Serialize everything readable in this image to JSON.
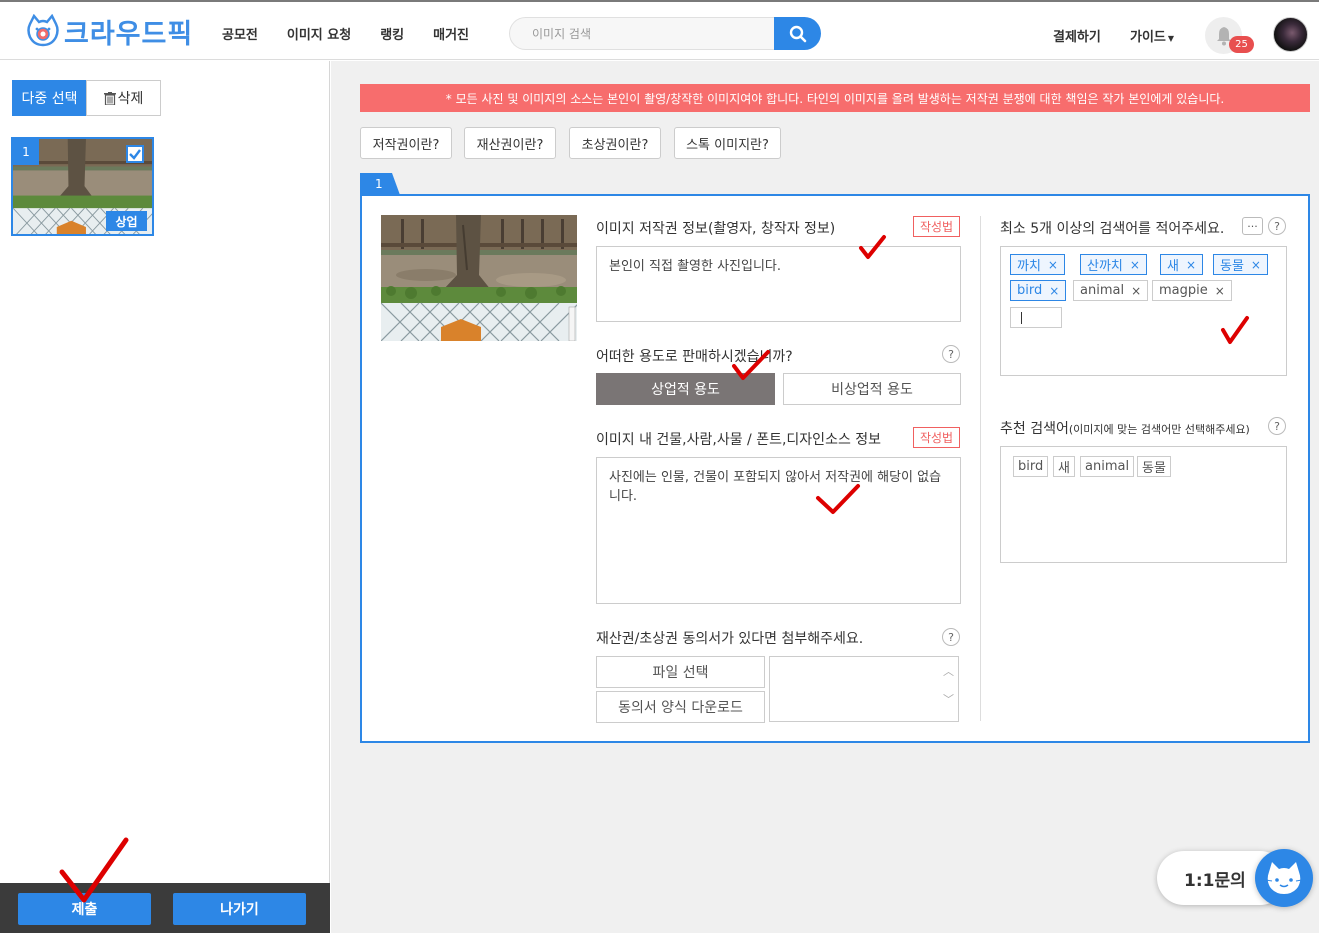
{
  "header": {
    "logo_text": "크라우드픽",
    "nav": [
      "공모전",
      "이미지 요청",
      "랭킹",
      "매거진"
    ],
    "search_placeholder": "이미지 검색",
    "payment_label": "결제하기",
    "guide_label": "가이드",
    "notification_count": "25"
  },
  "sidebar": {
    "multi_select_label": "다중 선택",
    "delete_label": "삭제",
    "thumbnail": {
      "number": "1",
      "usage_tag": "상업",
      "checked": true
    },
    "submit_label": "제출",
    "exit_label": "나가기"
  },
  "main": {
    "notice": "* 모든 사진 및 이미지의 소스는 본인이 촬영/창작한 이미지여야 합니다. 타인의 이미지를 올려 발생하는 저작권 분쟁에 대한 책임은 작가 본인에게 있습니다.",
    "info_buttons": [
      "저작권이란?",
      "재산권이란?",
      "초상권이란?",
      "스톡 이미지란?"
    ],
    "panel_number": "1",
    "copyright_label": "이미지 저작권 정보(촬영자, 창작자 정보)",
    "how_to_write": "작성법",
    "copyright_text": "본인이 직접 촬영한 사진입니다.",
    "usage_question": "어떠한 용도로 판매하시겠습니까?",
    "usage_commercial": "상업적 용도",
    "usage_noncommercial": "비상업적 용도",
    "usage_selected": "commercial",
    "content_label": "이미지 내 건물,사람,사물 / 폰트,디자인소스 정보",
    "content_text": "사진에는 인물, 건물이 포함되지 않아서 저작권에 해당이 없습니다.",
    "consent_label": "재산권/초상권 동의서가 있다면 첨부해주세요.",
    "file_select_label": "파일 선택",
    "consent_download_label": "동의서 양식 다운로드",
    "keywords_label": "최소 5개 이상의 검색어를 적어주세요.",
    "more_label": "···",
    "help_mark": "?",
    "keywords": [
      {
        "text": "까치",
        "style": "blue"
      },
      {
        "text": "산까치",
        "style": "blue"
      },
      {
        "text": "새",
        "style": "blue"
      },
      {
        "text": "동물",
        "style": "blue"
      },
      {
        "text": "bird",
        "style": "blue"
      },
      {
        "text": "animal",
        "style": "gray"
      },
      {
        "text": "magpie",
        "style": "gray"
      }
    ],
    "tag_remove": "×",
    "recommended_label": "추천 검색어",
    "recommended_sub": "(이미지에 맞는 검색어만 선택해주세요)",
    "recommended": [
      "bird",
      "새",
      "animal",
      "동물"
    ]
  },
  "chat": {
    "label": "1:1문의"
  },
  "colors": {
    "accent": "#2d87e6",
    "notice": "#f76d6d",
    "selected_usage": "#7a7575",
    "annotation": "#dd0000"
  }
}
